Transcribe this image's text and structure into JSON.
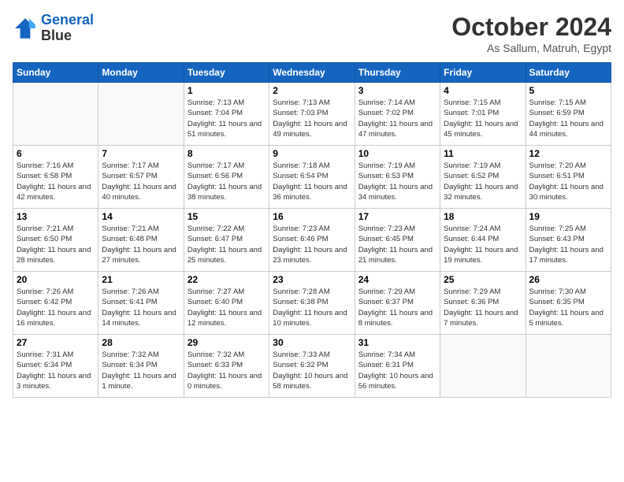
{
  "header": {
    "logo_line1": "General",
    "logo_line2": "Blue",
    "month": "October 2024",
    "location": "As Sallum, Matruh, Egypt"
  },
  "days_of_week": [
    "Sunday",
    "Monday",
    "Tuesday",
    "Wednesday",
    "Thursday",
    "Friday",
    "Saturday"
  ],
  "weeks": [
    [
      {
        "day": "",
        "info": ""
      },
      {
        "day": "",
        "info": ""
      },
      {
        "day": "1",
        "info": "Sunrise: 7:13 AM\nSunset: 7:04 PM\nDaylight: 11 hours and 51 minutes."
      },
      {
        "day": "2",
        "info": "Sunrise: 7:13 AM\nSunset: 7:03 PM\nDaylight: 11 hours and 49 minutes."
      },
      {
        "day": "3",
        "info": "Sunrise: 7:14 AM\nSunset: 7:02 PM\nDaylight: 11 hours and 47 minutes."
      },
      {
        "day": "4",
        "info": "Sunrise: 7:15 AM\nSunset: 7:01 PM\nDaylight: 11 hours and 45 minutes."
      },
      {
        "day": "5",
        "info": "Sunrise: 7:15 AM\nSunset: 6:59 PM\nDaylight: 11 hours and 44 minutes."
      }
    ],
    [
      {
        "day": "6",
        "info": "Sunrise: 7:16 AM\nSunset: 6:58 PM\nDaylight: 11 hours and 42 minutes."
      },
      {
        "day": "7",
        "info": "Sunrise: 7:17 AM\nSunset: 6:57 PM\nDaylight: 11 hours and 40 minutes."
      },
      {
        "day": "8",
        "info": "Sunrise: 7:17 AM\nSunset: 6:56 PM\nDaylight: 11 hours and 38 minutes."
      },
      {
        "day": "9",
        "info": "Sunrise: 7:18 AM\nSunset: 6:54 PM\nDaylight: 11 hours and 36 minutes."
      },
      {
        "day": "10",
        "info": "Sunrise: 7:19 AM\nSunset: 6:53 PM\nDaylight: 11 hours and 34 minutes."
      },
      {
        "day": "11",
        "info": "Sunrise: 7:19 AM\nSunset: 6:52 PM\nDaylight: 11 hours and 32 minutes."
      },
      {
        "day": "12",
        "info": "Sunrise: 7:20 AM\nSunset: 6:51 PM\nDaylight: 11 hours and 30 minutes."
      }
    ],
    [
      {
        "day": "13",
        "info": "Sunrise: 7:21 AM\nSunset: 6:50 PM\nDaylight: 11 hours and 28 minutes."
      },
      {
        "day": "14",
        "info": "Sunrise: 7:21 AM\nSunset: 6:48 PM\nDaylight: 11 hours and 27 minutes."
      },
      {
        "day": "15",
        "info": "Sunrise: 7:22 AM\nSunset: 6:47 PM\nDaylight: 11 hours and 25 minutes."
      },
      {
        "day": "16",
        "info": "Sunrise: 7:23 AM\nSunset: 6:46 PM\nDaylight: 11 hours and 23 minutes."
      },
      {
        "day": "17",
        "info": "Sunrise: 7:23 AM\nSunset: 6:45 PM\nDaylight: 11 hours and 21 minutes."
      },
      {
        "day": "18",
        "info": "Sunrise: 7:24 AM\nSunset: 6:44 PM\nDaylight: 11 hours and 19 minutes."
      },
      {
        "day": "19",
        "info": "Sunrise: 7:25 AM\nSunset: 6:43 PM\nDaylight: 11 hours and 17 minutes."
      }
    ],
    [
      {
        "day": "20",
        "info": "Sunrise: 7:26 AM\nSunset: 6:42 PM\nDaylight: 11 hours and 16 minutes."
      },
      {
        "day": "21",
        "info": "Sunrise: 7:26 AM\nSunset: 6:41 PM\nDaylight: 11 hours and 14 minutes."
      },
      {
        "day": "22",
        "info": "Sunrise: 7:27 AM\nSunset: 6:40 PM\nDaylight: 11 hours and 12 minutes."
      },
      {
        "day": "23",
        "info": "Sunrise: 7:28 AM\nSunset: 6:38 PM\nDaylight: 11 hours and 10 minutes."
      },
      {
        "day": "24",
        "info": "Sunrise: 7:29 AM\nSunset: 6:37 PM\nDaylight: 11 hours and 8 minutes."
      },
      {
        "day": "25",
        "info": "Sunrise: 7:29 AM\nSunset: 6:36 PM\nDaylight: 11 hours and 7 minutes."
      },
      {
        "day": "26",
        "info": "Sunrise: 7:30 AM\nSunset: 6:35 PM\nDaylight: 11 hours and 5 minutes."
      }
    ],
    [
      {
        "day": "27",
        "info": "Sunrise: 7:31 AM\nSunset: 6:34 PM\nDaylight: 11 hours and 3 minutes."
      },
      {
        "day": "28",
        "info": "Sunrise: 7:32 AM\nSunset: 6:34 PM\nDaylight: 11 hours and 1 minute."
      },
      {
        "day": "29",
        "info": "Sunrise: 7:32 AM\nSunset: 6:33 PM\nDaylight: 11 hours and 0 minutes."
      },
      {
        "day": "30",
        "info": "Sunrise: 7:33 AM\nSunset: 6:32 PM\nDaylight: 10 hours and 58 minutes."
      },
      {
        "day": "31",
        "info": "Sunrise: 7:34 AM\nSunset: 6:31 PM\nDaylight: 10 hours and 56 minutes."
      },
      {
        "day": "",
        "info": ""
      },
      {
        "day": "",
        "info": ""
      }
    ]
  ]
}
